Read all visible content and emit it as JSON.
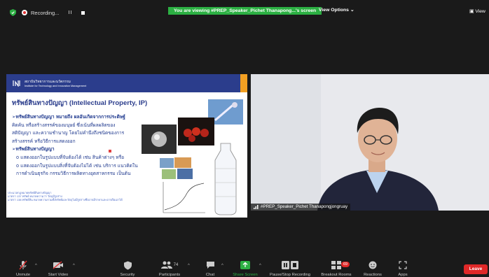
{
  "topbar": {
    "recording_label": "Recording...",
    "recording_controls": "II",
    "viewing_banner": "You are viewing #PREP_Speaker_Pichet Thanapong...'s screen",
    "view_options": "View Options",
    "view_label": "View"
  },
  "slide": {
    "org_line1": "สถาบันวิทยาการและนวัตกรรม",
    "org_line2": "Institute for Technology and Innovation Management",
    "title": "ทรัพย์สินทางปัญญา (Intellectual Property, IP)",
    "bullet1": "ทรัพย์สินทางปัญญา หมายถึง ผลอันเกิดจากการประดิษฐ์",
    "bullet1_l2": "คิดค้น หรือสร้างสรรค์ของมนุษย์ ซึ่งเน้นที่ผลผลิตของ",
    "bullet1_l3": "สติปัญญา และความชำนาญ โดยไม่คำนึงถึงชนิดของการ",
    "bullet1_l4": "สร้างสรรค์ หรือวิธีการแสดงออก",
    "bullet2": "ทรัพย์สินทางปัญญา",
    "sub1": "แสดงออกในรูปแบบที่จับต้องได้ เช่น สินค้าต่างๆ หรือ",
    "sub2": "แสดงออกในรูปแบบสิ่งที่จับต้องไม่ได้ เช่น บริการ แนวคิดใน",
    "sub2_l2": "การดำเนินธุรกิจ กรรมวิธีการผลิตทางอุตสาหกรรม เป็นต้น",
    "foot1": "ประมวลกฎหมายทรัพย์สินทางปัญญา",
    "foot2": "มาตรา 137 ทรัพย์ หมายความว่า วัตถุมีรูปร่าง",
    "foot3": "มาตรา 138 ทรัพย์สิน หมายความรวมทั้งทรัพย์และวัตถุไม่มีรูปร่างซึ่งอาจมีราคาและอาจถือเอาได้"
  },
  "video": {
    "participant_name": "#PREP_Speaker_Pichet Thanapongjongruay"
  },
  "toolbar": {
    "unmute": "Unmute",
    "start_video": "Start Video",
    "security": "Security",
    "participants": "Participants",
    "participants_count": "74",
    "chat": "Chat",
    "share_screen": "Share Screen",
    "pause_recording": "Pause/Stop Recording",
    "breakout_rooms": "Breakout Rooms",
    "breakout_badge": "69",
    "reactions": "Reactions",
    "apps": "Apps",
    "leave": "Leave"
  },
  "colors": {
    "accent_green": "#2cb043",
    "leave_red": "#e02828",
    "slide_blue": "#2b3d8c",
    "slide_orange": "#f2a022"
  }
}
